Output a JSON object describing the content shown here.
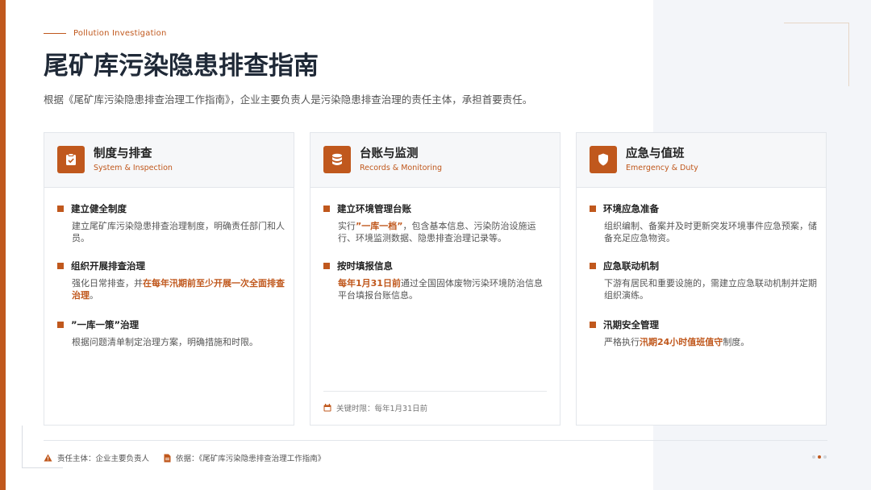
{
  "header": {
    "kicker": "Pollution Investigation",
    "title": "尾矿库污染隐患排查指南",
    "subtitle": "根据《尾矿库污染隐患排查治理工作指南》，企业主要负责人是污染隐患排查治理的责任主体，承担首要责任。"
  },
  "cards": [
    {
      "title": "制度与排查",
      "subtitle": "System & Inspection",
      "icon": "clipboard-check-icon",
      "items": [
        {
          "title": "建立健全制度",
          "body": [
            "建立尾矿库污染隐患排查治理制度，明确责任部门和人员。"
          ]
        },
        {
          "title": "组织开展排查治理",
          "body_pre": "强化日常排查，并",
          "highlight": "在每年汛期前至少开展一次全面排查治理",
          "body_post": "。"
        },
        {
          "title": "”一库一策”治理",
          "body": [
            "根据问题清单制定治理方案，明确措施和时限。"
          ]
        }
      ]
    },
    {
      "title": "台账与监测",
      "subtitle": "Records & Monitoring",
      "icon": "database-icon",
      "items": [
        {
          "title": "建立环境管理台账",
          "body_pre": "实行",
          "highlight": "”一库一档”",
          "body_post": "，包含基本信息、污染防治设施运行、环境监测数据、隐患排查治理记录等。"
        },
        {
          "title": "按时填报信息",
          "body_pre": "",
          "highlight": "每年1月31日前",
          "body_post": "通过全国固体废物污染环境防治信息平台填报台账信息。"
        }
      ],
      "footer": "关键时限：每年1月31日前"
    },
    {
      "title": "应急与值班",
      "subtitle": "Emergency & Duty",
      "icon": "shield-icon",
      "items": [
        {
          "title": "环境应急准备",
          "body": [
            "组织编制、备案并及时更新突发环境事件应急预案，储备充足应急物资。"
          ]
        },
        {
          "title": "应急联动机制",
          "body": [
            "下游有居民和重要设施的，需建立应急联动机制并定期组织演练。"
          ]
        },
        {
          "title": "汛期安全管理",
          "body_pre": "严格执行",
          "highlight": "汛期24小时值班值守",
          "body_post": "制度。"
        }
      ]
    }
  ],
  "footer": {
    "responsibility": "责任主体：企业主要负责人",
    "basis": "依据：《尾矿库污染隐患排查治理工作指南》",
    "page_dots": 3,
    "active_dot": 2
  },
  "colors": {
    "accent": "#c0581d",
    "text": "#1f2937",
    "muted": "#555555"
  }
}
